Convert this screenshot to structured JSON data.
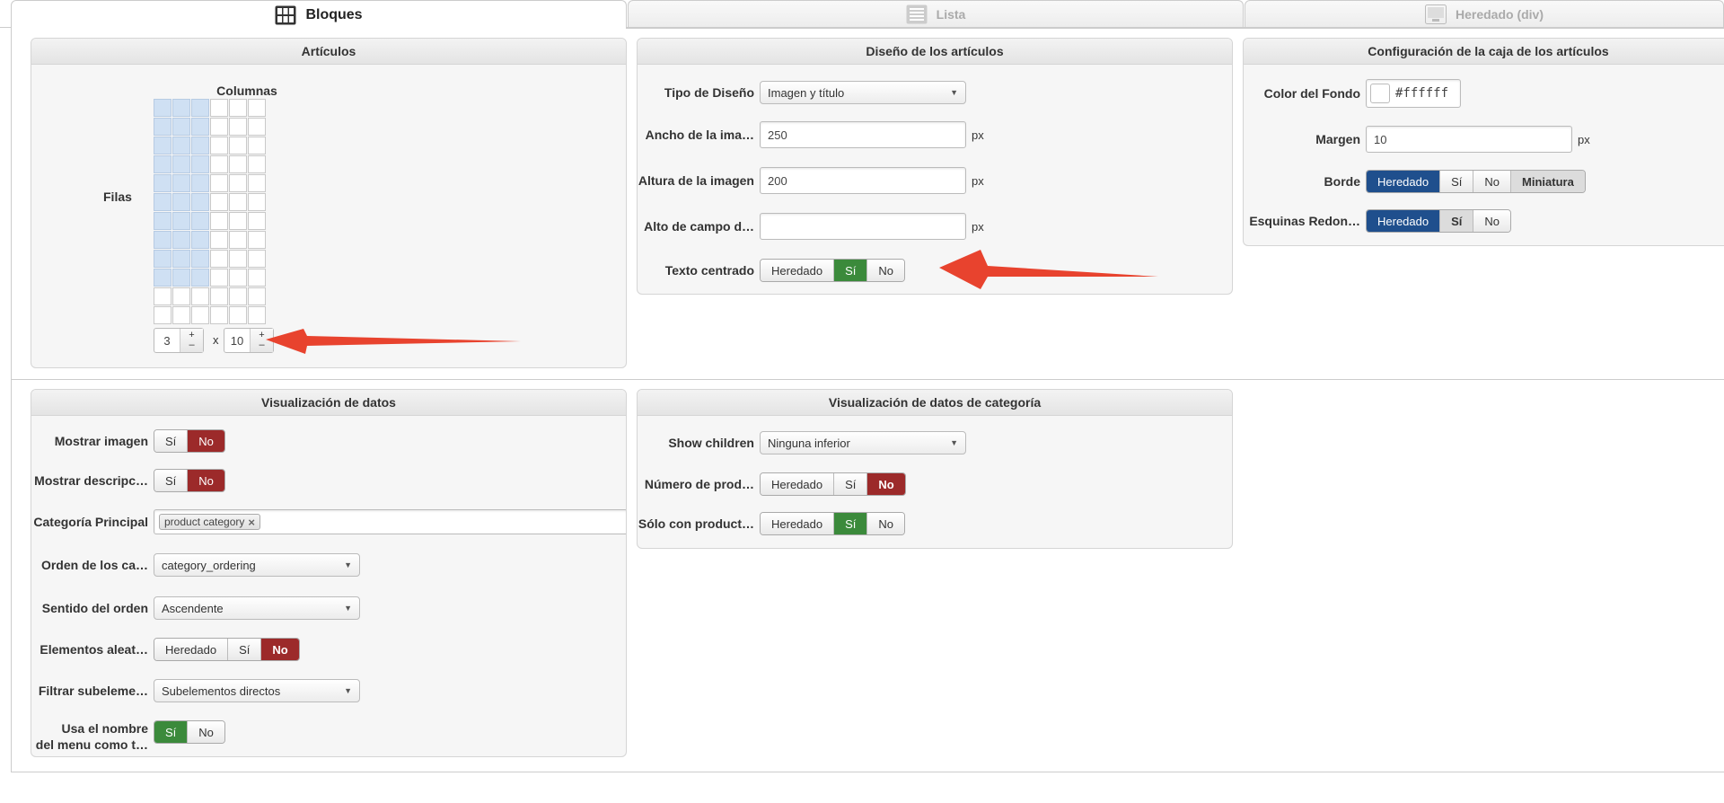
{
  "tabs": [
    {
      "label": "Bloques",
      "icon": "blocks-grid-icon",
      "active": true
    },
    {
      "label": "Lista",
      "icon": "list-icon",
      "active": false
    },
    {
      "label": "Heredado (div)",
      "icon": "inherited-div-icon",
      "active": false
    }
  ],
  "articulos": {
    "title": "Artículos",
    "columns_label": "Columnas",
    "rows_label": "Filas",
    "cols_value": "3",
    "rows_value": "10",
    "times": "x",
    "plus": "+",
    "minus": "–"
  },
  "diseno": {
    "title": "Diseño de los artículos",
    "tipo_label": "Tipo de Diseño",
    "tipo_value": "Imagen y título",
    "ancho_label": "Ancho de la ima…",
    "ancho_value": "250",
    "altura_label": "Altura de la imagen",
    "altura_value": "200",
    "alto_label": "Alto de campo d…",
    "alto_value": "",
    "unit": "px",
    "texto_label": "Texto centrado",
    "texto_opts": [
      "Heredado",
      "Sí",
      "No"
    ]
  },
  "caja": {
    "title": "Configuración de la caja de los artículos",
    "color_label": "Color del Fondo",
    "color_value": "#ffffff",
    "margen_label": "Margen",
    "margen_value": "10",
    "unit": "px",
    "borde_label": "Borde",
    "borde_opts": [
      "Heredado",
      "Sí",
      "No",
      "Miniatura"
    ],
    "esquinas_label": "Esquinas Redon…",
    "esquinas_opts": [
      "Heredado",
      "Sí",
      "No"
    ]
  },
  "visualizacion": {
    "title": "Visualización de datos",
    "mostrar_imagen_label": "Mostrar imagen",
    "mostrar_desc_label": "Mostrar descripc…",
    "yes_no": [
      "Sí",
      "No"
    ],
    "categoria_label": "Categoría Principal",
    "categoria_tag": "product category",
    "tag_remove": "×",
    "orden_label": "Orden de los ca…",
    "orden_value": "category_ordering",
    "sentido_label": "Sentido del orden",
    "sentido_value": "Ascendente",
    "aleat_label": "Elementos aleat…",
    "aleat_opts": [
      "Heredado",
      "Sí",
      "No"
    ],
    "filtrar_label": "Filtrar subeleme…",
    "filtrar_value": "Subelementos directos",
    "usa_label_1": "Usa el nombre",
    "usa_label_2": "del menu como t…"
  },
  "categoria": {
    "title": "Visualización de datos de categoría",
    "children_label": "Show children",
    "children_value": "Ninguna inferior",
    "numero_label": "Número de prod…",
    "numero_opts": [
      "Heredado",
      "Sí",
      "No"
    ],
    "solo_label": "Sólo con product…",
    "solo_opts": [
      "Heredado",
      "Sí",
      "No"
    ]
  },
  "colors": {
    "accent_blue": "#1f4f8d",
    "active_green": "#3b8a3b",
    "active_red": "#9c2a2a",
    "arrow_red": "#e8432e",
    "grid_selected": "#cfe0f3"
  }
}
